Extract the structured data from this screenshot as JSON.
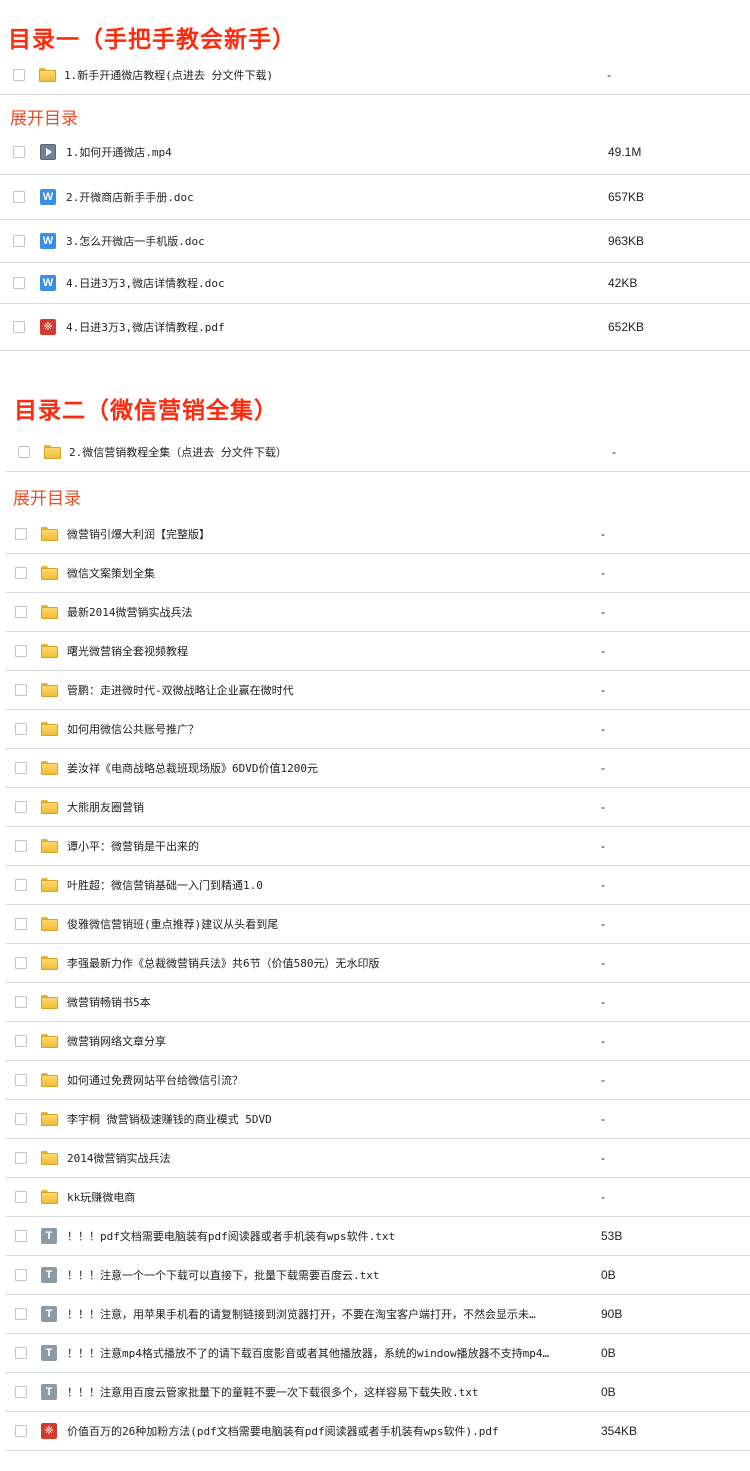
{
  "section1": {
    "title": "目录一（手把手教会新手）",
    "folder": {
      "name": "1.新手开通微店教程(点进去 分文件下载)",
      "size": "-"
    },
    "expand_label": "展开目录",
    "files": [
      {
        "icon": "video",
        "name": "1.如何开通微店.mp4",
        "size": "49.1M"
      },
      {
        "icon": "word",
        "name": "2.开微商店新手手册.doc",
        "size": "657KB"
      },
      {
        "icon": "word",
        "name": "3.怎么开微店一手机版.doc",
        "size": "963KB"
      },
      {
        "icon": "word",
        "name": "4.日进3万3,微店详情教程.doc",
        "size": "42KB"
      },
      {
        "icon": "pdf",
        "name": "4.日进3万3,微店详情教程.pdf",
        "size": "652KB"
      }
    ]
  },
  "section2": {
    "title": "目录二（微信营销全集）",
    "folder": {
      "name": "2.微信营销教程全集（点进去 分文件下载）",
      "size": "-"
    },
    "expand_label": "展开目录",
    "files": [
      {
        "icon": "folder",
        "name": "微营销引爆大利润【完整版】",
        "size": "-"
      },
      {
        "icon": "folder",
        "name": "微信文案策划全集",
        "size": "-"
      },
      {
        "icon": "folder",
        "name": "最新2014微营销实战兵法",
        "size": "-"
      },
      {
        "icon": "folder",
        "name": "曙光微营销全套视频教程",
        "size": "-"
      },
      {
        "icon": "folder",
        "name": "管鹏：走进微时代-双微战略让企业赢在微时代",
        "size": "-"
      },
      {
        "icon": "folder",
        "name": "如何用微信公共账号推广？",
        "size": "-"
      },
      {
        "icon": "folder",
        "name": "姜汝祥《电商战略总裁班现场版》6DVD价值1200元",
        "size": "-"
      },
      {
        "icon": "folder",
        "name": "大熊朋友圈营销",
        "size": "-"
      },
      {
        "icon": "folder",
        "name": "谭小平：微营销是干出来的",
        "size": "-"
      },
      {
        "icon": "folder",
        "name": "叶胜超：微信营销基础一入门到精通1.0",
        "size": "-"
      },
      {
        "icon": "folder",
        "name": "俊雅微信营销班(重点推荐)建议从头看到尾",
        "size": "-"
      },
      {
        "icon": "folder",
        "name": "李强最新力作《总裁微营销兵法》共6节（价值580元）无水印版",
        "size": "-"
      },
      {
        "icon": "folder",
        "name": "微营销畅销书5本",
        "size": "-"
      },
      {
        "icon": "folder",
        "name": "微营销网络文章分享",
        "size": "-"
      },
      {
        "icon": "folder",
        "name": "如何通过免费网站平台给微信引流？",
        "size": "-"
      },
      {
        "icon": "folder",
        "name": "李宇桐 微营销极速赚钱的商业模式 5DVD",
        "size": "-"
      },
      {
        "icon": "folder",
        "name": "2014微营销实战兵法",
        "size": "-"
      },
      {
        "icon": "folder",
        "name": "kk玩赚微电商",
        "size": "-"
      },
      {
        "icon": "txt",
        "name": "！！！pdf文档需要电脑装有pdf阅读器或者手机装有wps软件.txt",
        "size": "53B"
      },
      {
        "icon": "txt",
        "name": "！！！注意一个一个下载可以直接下，批量下载需要百度云.txt",
        "size": "0B"
      },
      {
        "icon": "txt",
        "name": "！！！注意，用苹果手机看的请复制链接到浏览器打开，不要在淘宝客户端打开，不然会显示未…",
        "size": "90B"
      },
      {
        "icon": "txt",
        "name": "！！！注意mp4格式播放不了的请下载百度影音或者其他播放器，系统的window播放器不支持mp4…",
        "size": "0B"
      },
      {
        "icon": "txt",
        "name": "！！！注意用百度云管家批量下的童鞋不要一次下载很多个，这样容易下载失败.txt",
        "size": "0B"
      },
      {
        "icon": "pdf",
        "name": "价值百万的26种加粉方法(pdf文档需要电脑装有pdf阅读器或者手机装有wps软件).pdf",
        "size": "354KB"
      }
    ]
  },
  "colors": {
    "title_red": "#ff2a0e",
    "expand_red": "#ef4b28",
    "divider": "#d7dde5"
  }
}
